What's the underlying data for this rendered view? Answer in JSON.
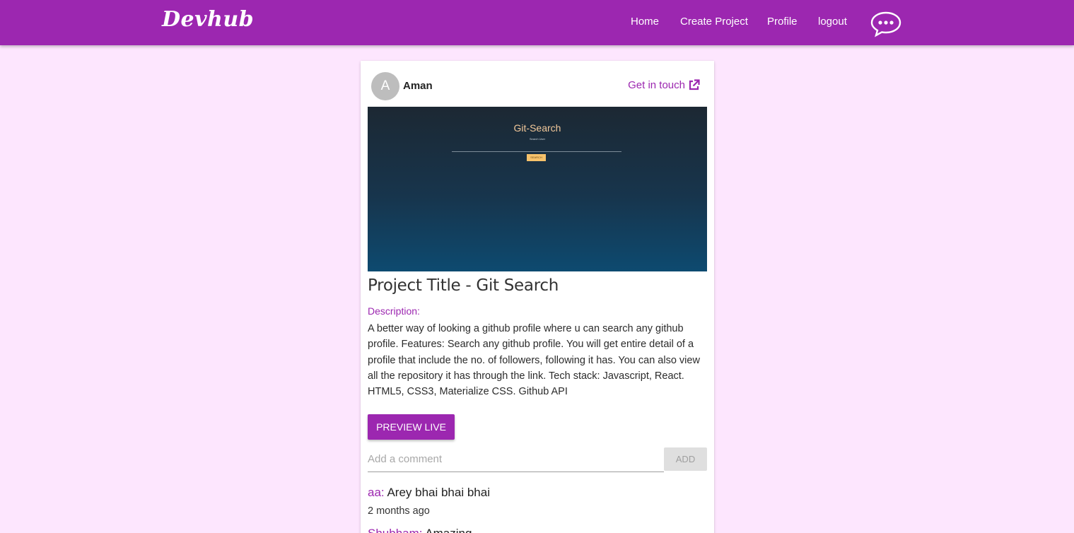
{
  "header": {
    "brand": "Devhub",
    "nav": [
      {
        "label": "Home"
      },
      {
        "label": "Create Project"
      },
      {
        "label": "Profile"
      },
      {
        "label": "logout"
      }
    ]
  },
  "post": {
    "author": {
      "initial": "A",
      "name": "Aman"
    },
    "contact_label": "Get in touch",
    "preview_image": {
      "title": "Git-Search",
      "subtitle": "Search User",
      "button": "SEARCH"
    },
    "title": "Project Title - Git Search",
    "description_label": "Description:",
    "description": "A better way of looking a github profile where u can search any github profile. Features: Search any github profile. You will get entire detail of a profile that include the no. of followers, following it has. You can also view all the repository it has through the link. Tech stack: Javascript, React. HTML5, CSS3, Materialize CSS. Github API",
    "preview_button": "PREVIEW LIVE",
    "comment_form": {
      "placeholder": "Add a comment",
      "value": "",
      "button": "ADD"
    },
    "comments": [
      {
        "user": "aa:",
        "text": "Arey bhai bhai bhai",
        "time": "2 months ago"
      },
      {
        "user": "Shubham:",
        "text": "Amazing",
        "time": ""
      }
    ]
  },
  "colors": {
    "primary": "#9c27b0",
    "background": "#fde6fe"
  }
}
